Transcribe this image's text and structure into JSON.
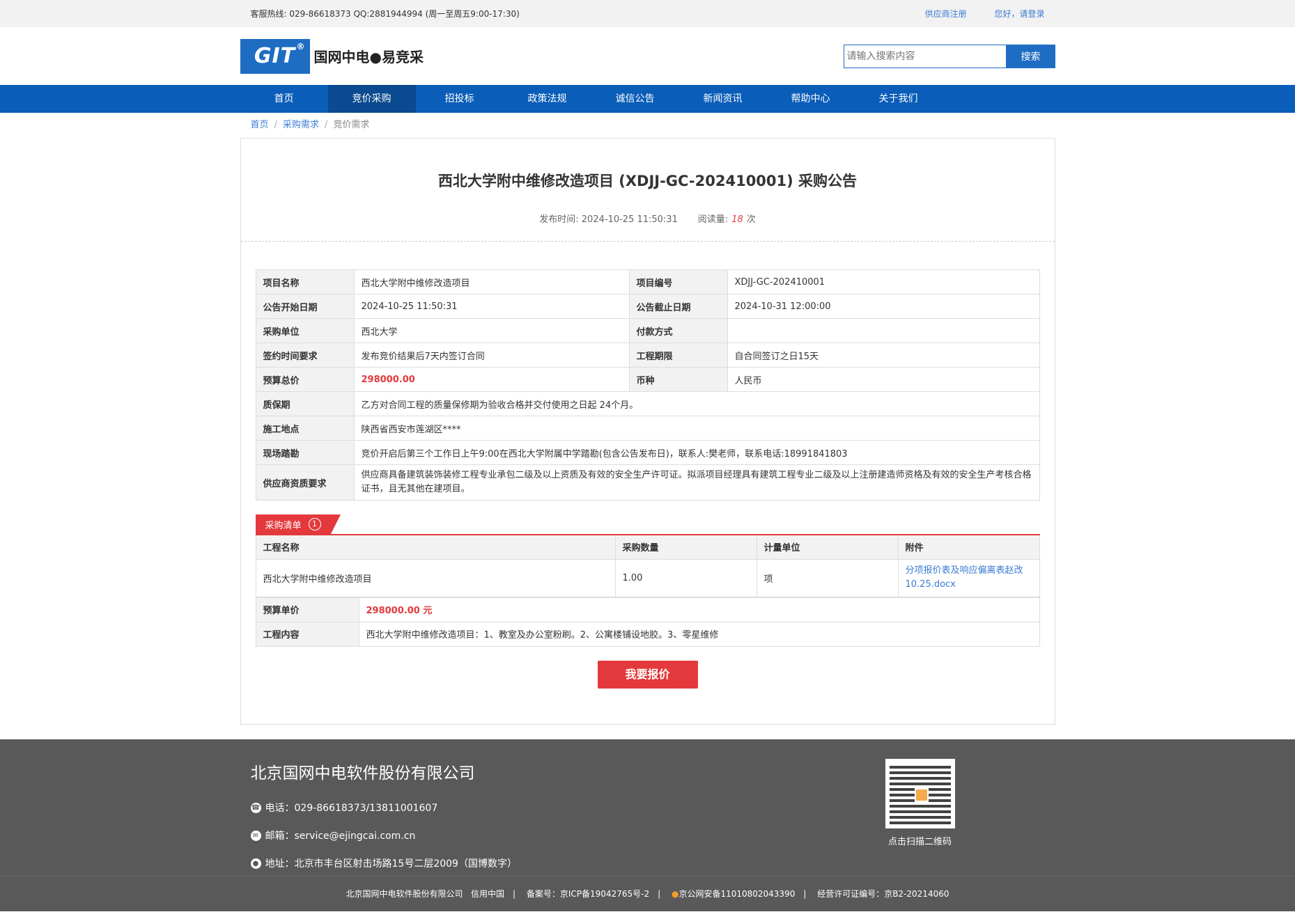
{
  "topbar": {
    "hotline": "客服热线: 029-86618373 QQ:2881944994 (周一至周五9:00-17:30)",
    "register": "供应商注册",
    "login": "您好，请登录"
  },
  "header": {
    "logo_mark": "GIT",
    "logo_reg": "®",
    "logo_text": "国网中电●易竞采",
    "search_placeholder": "请输入搜索内容",
    "search_button": "搜索"
  },
  "nav": {
    "items": [
      "首页",
      "竞价采购",
      "招投标",
      "政策法规",
      "诚信公告",
      "新闻资讯",
      "帮助中心",
      "关于我们"
    ],
    "active_index": 1
  },
  "breadcrumb": {
    "items": [
      "首页",
      "采购需求",
      "竞价需求"
    ],
    "sep": "/"
  },
  "notice": {
    "title": "西北大学附中维修改造项目 (XDJJ-GC-202410001) 采购公告",
    "publish_label": "发布时间:",
    "publish_time": "2024-10-25 11:50:31",
    "read_label": "阅读量:",
    "read_count": "18",
    "read_unit": "次"
  },
  "info": {
    "project_name_label": "项目名称",
    "project_name": "西北大学附中维修改造项目",
    "project_no_label": "项目编号",
    "project_no": "XDJJ-GC-202410001",
    "start_label": "公告开始日期",
    "start": "2024-10-25 11:50:31",
    "end_label": "公告截止日期",
    "end": "2024-10-31 12:00:00",
    "buyer_label": "采购单位",
    "buyer": "西北大学",
    "payment_label": "付款方式",
    "payment": "",
    "sign_label": "签约时间要求",
    "sign": "发布竞价结果后7天内签订合同",
    "period_label": "工程期限",
    "period": "自合同签订之日15天",
    "budget_label": "预算总价",
    "budget": "298000.00",
    "currency_label": "币种",
    "currency": "人民币",
    "warranty_label": "质保期",
    "warranty": "乙方对合同工程的质量保修期为验收合格并交付使用之日起 24个月。",
    "site_label": "施工地点",
    "site": "陕西省西安市莲湖区****",
    "survey_label": "现场踏勘",
    "survey": "竞价开启后第三个工作日上午9:00在西北大学附属中学踏勘(包含公告发布日)，联系人:樊老师，联系电话:18991841803",
    "qual_label": "供应商资质要求",
    "qual": "供应商具备建筑装饰装修工程专业承包二级及以上资质及有效的安全生产许可证。拟派项目经理具有建筑工程专业二级及以上注册建造师资格及有效的安全生产考核合格证书，且无其他在建项目。"
  },
  "list": {
    "tag": "采购清单",
    "count": "1",
    "headers": [
      "工程名称",
      "采购数量",
      "计量单位",
      "附件"
    ],
    "row": {
      "name": "西北大学附中维修改造项目",
      "qty": "1.00",
      "unit": "项",
      "attachment": "分项报价表及响应偏离表赵改10.25.docx"
    },
    "unit_price_label": "预算单价",
    "unit_price": "298000.00 元",
    "content_label": "工程内容",
    "content": "西北大学附中维修改造项目：1、教室及办公室粉刷。2、公寓楼铺设地胶。3、零星维修"
  },
  "quote_button": "我要报价",
  "footer": {
    "company": "北京国网中电软件股份有限公司",
    "phone": "电话：029-86618373/13811001607",
    "email": "邮箱：service@ejingcai.com.cn",
    "address": "地址：北京市丰台区射击场路15号二层2009（国博数字）",
    "qr_caption": "点击扫描二维码",
    "bottom_company": "北京国网中电软件股份有限公司",
    "bottom_credit": "信用中国",
    "bottom_icp": "备案号：京ICP备19042765号-2",
    "bottom_police": "京公网安备11010802043390",
    "bottom_license": "经营许可证编号：京B2-20214060"
  },
  "colors": {
    "brand_blue": "#1e6dc3",
    "nav_blue": "#0a5db8",
    "accent_red": "#e4393c",
    "footer_gray": "#595959"
  }
}
